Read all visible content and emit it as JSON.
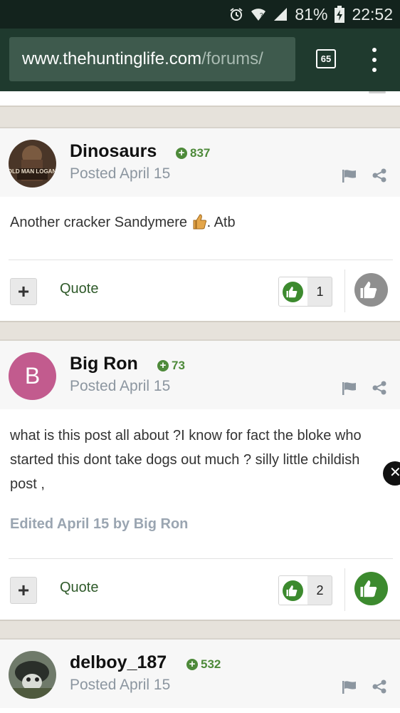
{
  "status_bar": {
    "battery": "81%",
    "time": "22:52"
  },
  "browser": {
    "url_domain": "www.thehuntinglife.com",
    "url_path": "/forums/",
    "tab_count": "65"
  },
  "posts": [
    {
      "username": "Dinosaurs",
      "reputation": "837",
      "posted": "Posted April 15",
      "body": "Another cracker Sandymere",
      "body_suffix": ". Atb",
      "quote_label": "Quote",
      "like_count": "1",
      "avatar_text": "OLD MAN LOGAN"
    },
    {
      "username": "Big Ron",
      "reputation": "73",
      "posted": "Posted April 15",
      "avatar_letter": "B",
      "body": "what is this  post all about ?I know for fact  the bloke who started this dont take dogs out much ? silly little childish post  ,",
      "edited": "Edited April 15 by Big Ron",
      "quote_label": "Quote",
      "like_count": "2"
    },
    {
      "username": "delboy_187",
      "reputation": "532",
      "posted": "Posted April 15"
    }
  ],
  "colors": {
    "accent_green": "#3c8a2e",
    "browser_bar": "#1f3a2e",
    "avatar_pink": "#c25b8e"
  }
}
